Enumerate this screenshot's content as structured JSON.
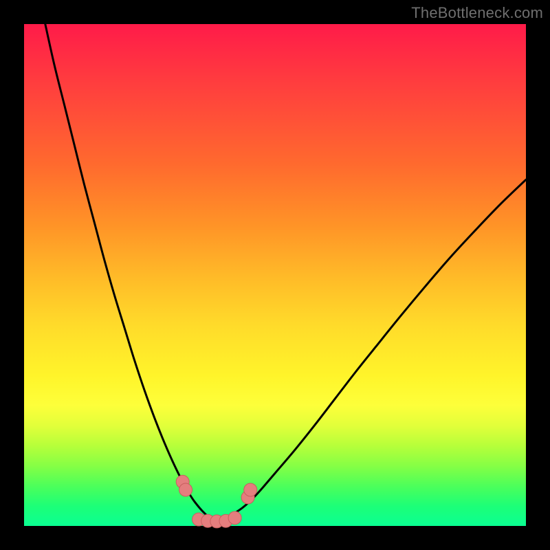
{
  "watermark": {
    "text": "TheBottleneck.com"
  },
  "colors": {
    "background": "#000000",
    "curve_stroke": "#000000",
    "marker_fill": "#e47e7e",
    "marker_stroke": "#c75e5e"
  },
  "chart_data": {
    "type": "line",
    "title": "",
    "xlabel": "",
    "ylabel": "",
    "xlim": [
      0,
      100
    ],
    "ylim": [
      0,
      100
    ],
    "grid": false,
    "series": [
      {
        "name": "bottleneck-curve-left",
        "x": [
          4,
          6,
          8,
          10,
          12,
          14,
          16,
          18,
          20,
          22,
          24,
          26,
          28,
          30,
          32,
          33,
          34,
          35.5,
          37,
          38
        ],
        "values": [
          101,
          92,
          84,
          76,
          68,
          60.5,
          53,
          46,
          39.5,
          33,
          27,
          21.5,
          16.5,
          12,
          8,
          6.3,
          4.8,
          3.0,
          1.6,
          1.0
        ]
      },
      {
        "name": "bottleneck-curve-right",
        "x": [
          38,
          39,
          40.5,
          42,
          43.5,
          45,
          47,
          50,
          54,
          58,
          62,
          66,
          70,
          75,
          80,
          85,
          90,
          95,
          100
        ],
        "values": [
          1.0,
          1.2,
          1.8,
          2.6,
          3.6,
          4.9,
          7.0,
          10.5,
          15.2,
          20.2,
          25.4,
          30.6,
          35.6,
          41.8,
          47.8,
          53.6,
          59.0,
          64.2,
          69.0
        ]
      }
    ],
    "markers": [
      {
        "x": 31.6,
        "y": 8.8
      },
      {
        "x": 32.2,
        "y": 7.2
      },
      {
        "x": 34.8,
        "y": 1.3
      },
      {
        "x": 36.6,
        "y": 1.0
      },
      {
        "x": 38.4,
        "y": 0.9
      },
      {
        "x": 40.2,
        "y": 1.0
      },
      {
        "x": 42.0,
        "y": 1.6
      },
      {
        "x": 44.6,
        "y": 5.7
      },
      {
        "x": 45.1,
        "y": 7.2
      }
    ]
  }
}
